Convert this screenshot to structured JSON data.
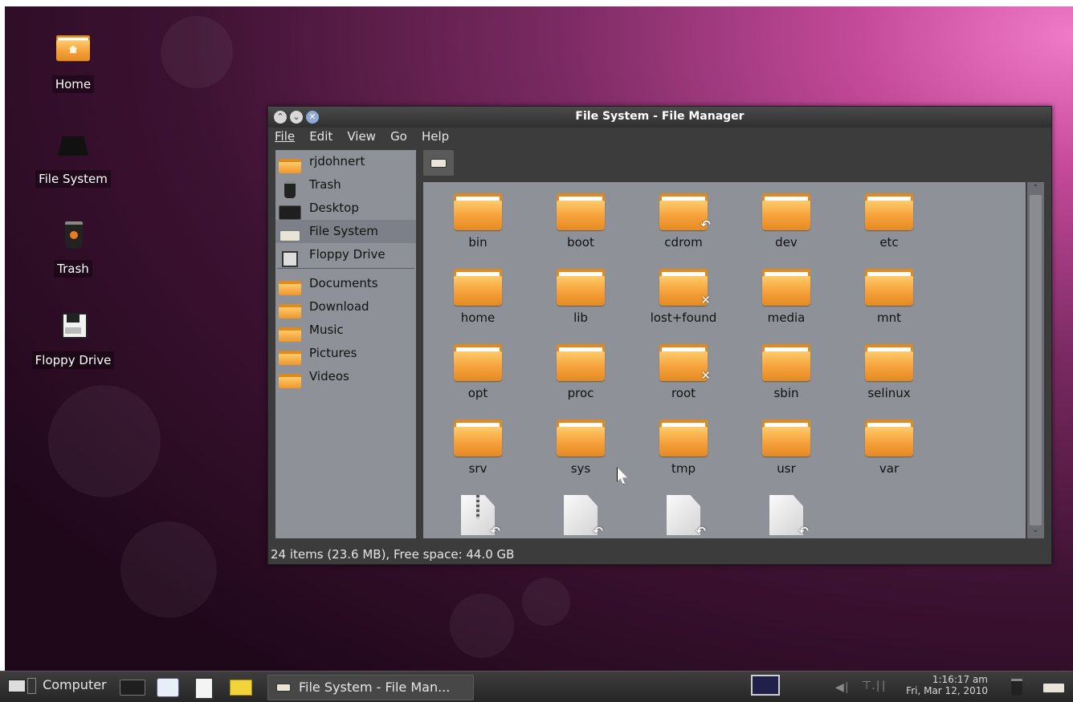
{
  "desktop": {
    "icons": [
      {
        "label": "Home",
        "icon": "home-folder-icon"
      },
      {
        "label": "File System",
        "icon": "drive-icon"
      },
      {
        "label": "Trash",
        "icon": "trash-icon"
      },
      {
        "label": "Floppy Drive",
        "icon": "floppy-icon"
      }
    ]
  },
  "window": {
    "title": "File System - File Manager",
    "menu": [
      "File",
      "Edit",
      "View",
      "Go",
      "Help"
    ],
    "sidebar": {
      "places": [
        {
          "label": "rjdohnert",
          "icon": "home-folder-icon"
        },
        {
          "label": "Trash",
          "icon": "trash-icon"
        },
        {
          "label": "Desktop",
          "icon": "desktop-icon"
        },
        {
          "label": "File System",
          "icon": "drive-icon",
          "selected": true
        },
        {
          "label": "Floppy Drive",
          "icon": "floppy-icon"
        }
      ],
      "bookmarks": [
        {
          "label": "Documents"
        },
        {
          "label": "Download"
        },
        {
          "label": "Music"
        },
        {
          "label": "Pictures"
        },
        {
          "label": "Videos"
        }
      ]
    },
    "files": [
      {
        "name": "bin",
        "kind": "folder"
      },
      {
        "name": "boot",
        "kind": "folder"
      },
      {
        "name": "cdrom",
        "kind": "folder",
        "emblem": "symlink"
      },
      {
        "name": "dev",
        "kind": "folder"
      },
      {
        "name": "etc",
        "kind": "folder"
      },
      {
        "name": "home",
        "kind": "folder"
      },
      {
        "name": "lib",
        "kind": "folder"
      },
      {
        "name": "lost+found",
        "kind": "folder",
        "emblem": "unreadable"
      },
      {
        "name": "media",
        "kind": "folder"
      },
      {
        "name": "mnt",
        "kind": "folder"
      },
      {
        "name": "opt",
        "kind": "folder"
      },
      {
        "name": "proc",
        "kind": "folder"
      },
      {
        "name": "root",
        "kind": "folder",
        "emblem": "unreadable"
      },
      {
        "name": "sbin",
        "kind": "folder"
      },
      {
        "name": "selinux",
        "kind": "folder"
      },
      {
        "name": "srv",
        "kind": "folder"
      },
      {
        "name": "sys",
        "kind": "folder"
      },
      {
        "name": "tmp",
        "kind": "folder"
      },
      {
        "name": "usr",
        "kind": "folder"
      },
      {
        "name": "var",
        "kind": "folder"
      },
      {
        "name": "",
        "kind": "archive",
        "emblem": "symlink"
      },
      {
        "name": "",
        "kind": "document",
        "emblem": "symlink"
      },
      {
        "name": "",
        "kind": "document",
        "emblem": "symlink"
      },
      {
        "name": "",
        "kind": "document",
        "emblem": "symlink"
      }
    ],
    "status": "24 items (23.6 MB), Free space: 44.0 GB"
  },
  "taskbar": {
    "menu_label": "Computer",
    "task_label": "File System - File Man...",
    "clock_time": "1:16:17 am",
    "clock_date": "Fri, Mar 12, 2010"
  },
  "colors": {
    "folder": "#f5a03a",
    "pane": "#8e9198",
    "window_chrome": "#3c3c3c"
  }
}
